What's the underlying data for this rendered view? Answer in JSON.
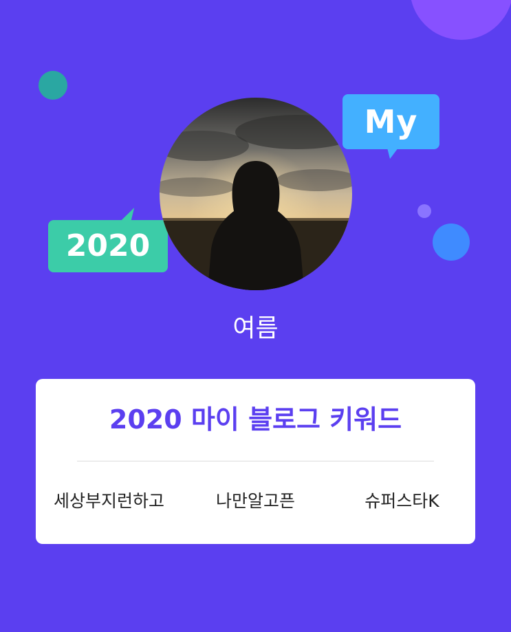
{
  "user": {
    "name": "여름"
  },
  "bubbles": {
    "my": "My",
    "year": "2020"
  },
  "card": {
    "title": "2020 마이 블로그 키워드",
    "keywords": [
      "세상부지런하고",
      "나만알고픈",
      "슈퍼스타K"
    ]
  },
  "colors": {
    "background": "#5b3ff0",
    "card": "#ffffff",
    "title": "#5b3ff0",
    "bubble_my": "#43b0ff",
    "bubble_year": "#3ccca8"
  },
  "icons": [
    "profile-photo-silhouette"
  ]
}
